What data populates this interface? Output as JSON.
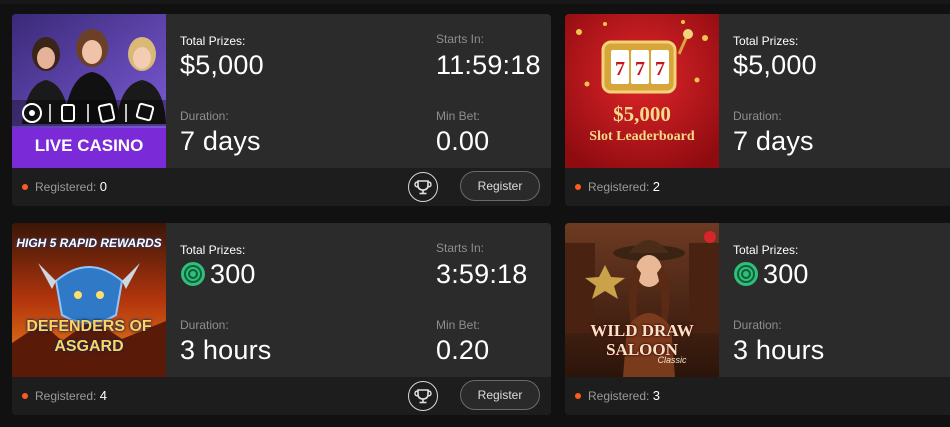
{
  "labels": {
    "total_prizes": "Total Prizes:",
    "starts_in": "Starts In:",
    "duration": "Duration:",
    "min_bet": "Min Bet:",
    "registered": "Registered:",
    "register_button": "Register"
  },
  "tournaments": [
    {
      "thumb_text": "LIVE CASINO",
      "total_prizes": "$5,000",
      "starts_in": "11:59:18",
      "duration": "7 days",
      "min_bet": "0.00",
      "registered": "0"
    },
    {
      "thumb_text": "$5,000",
      "thumb_subtext": "Slot Leaderboard",
      "total_prizes": "$5,000",
      "duration": "7 days",
      "registered": "2"
    },
    {
      "thumb_text_top": "HIGH 5 RAPID REWARDS",
      "thumb_text": "DEFENDERS OF ASGARD",
      "total_prizes": "300",
      "starts_in": "3:59:18",
      "duration": "3 hours",
      "min_bet": "0.20",
      "registered": "4"
    },
    {
      "thumb_text": "WILD DRAW SALOON",
      "thumb_subtext": "Classic",
      "total_prizes": "300",
      "duration": "3 hours",
      "registered": "3"
    }
  ],
  "colors": {
    "card_bg": "#2b2b2b",
    "footer_bg": "#1d1d1d",
    "registered_dot": "#ff5a1f",
    "coin_green": "#2fbf7a",
    "live_casino_purple": "#7a2ad6",
    "slot_red": "#c8141a"
  }
}
